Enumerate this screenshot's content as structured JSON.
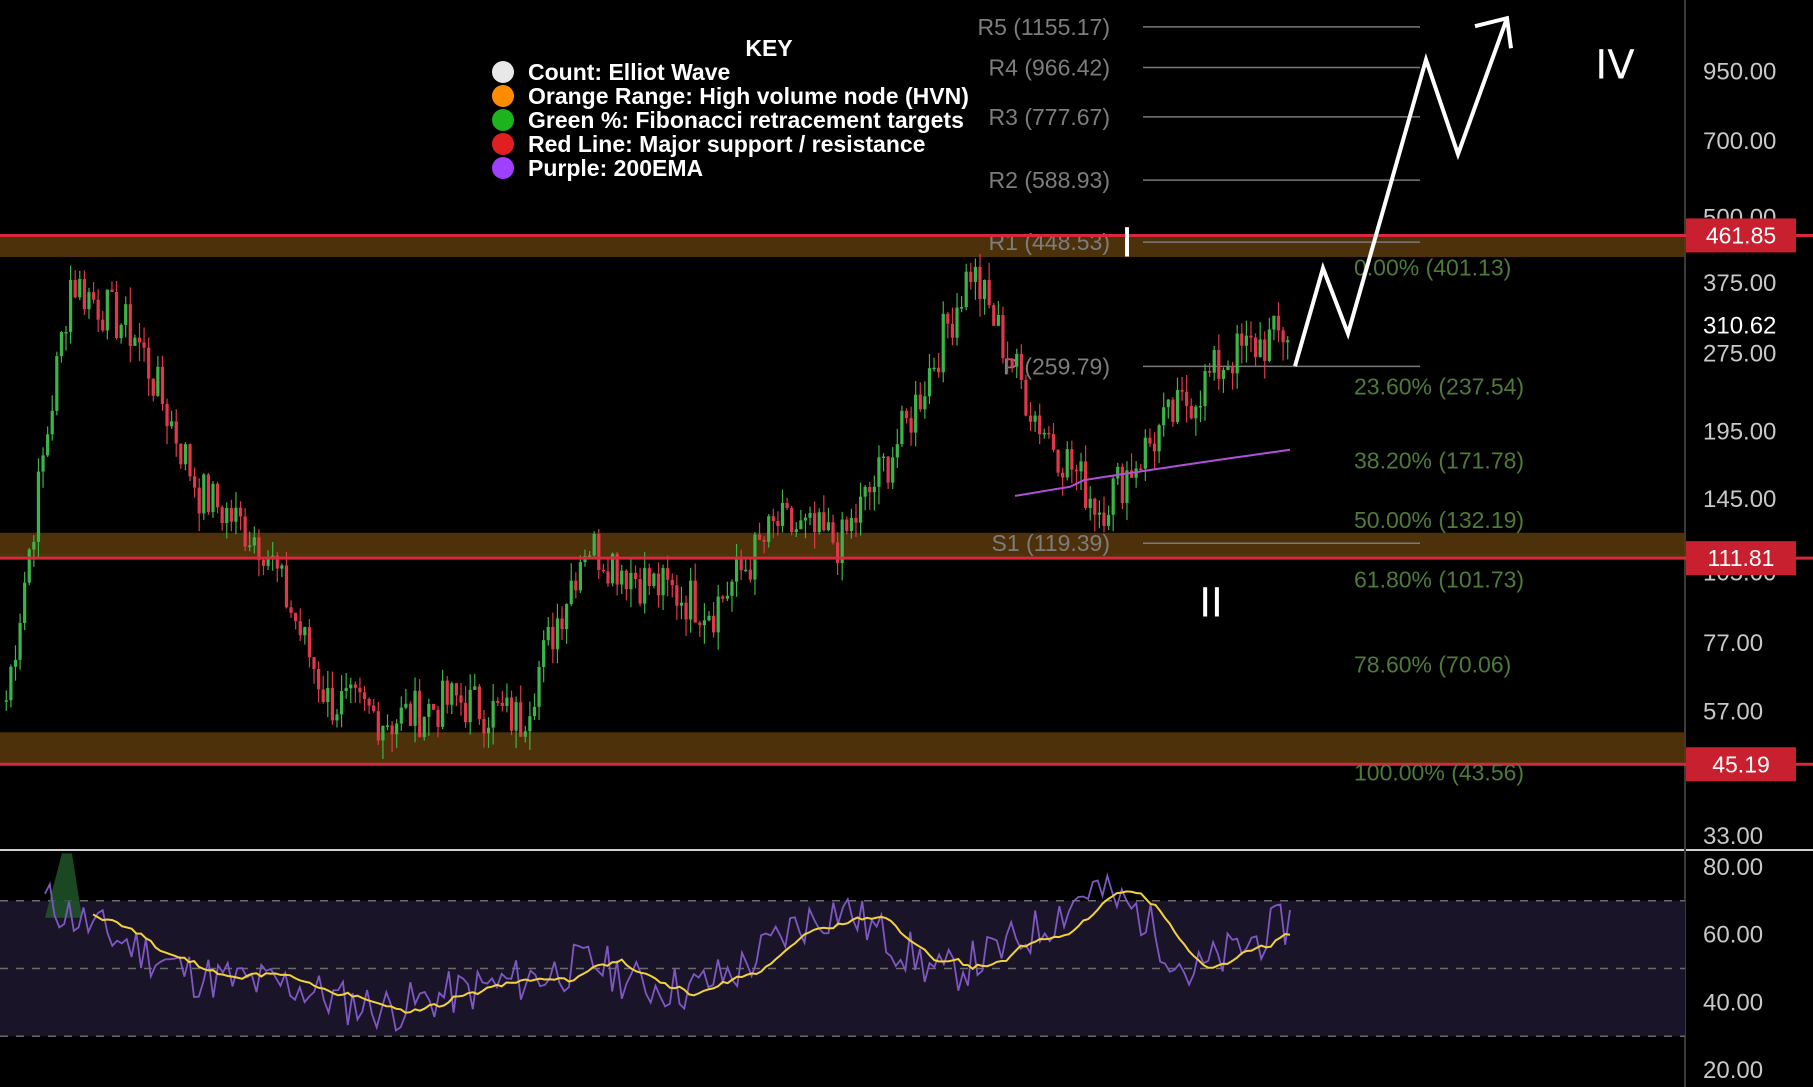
{
  "chart_data": {
    "type": "candlestick",
    "price_axis": {
      "scale": "log",
      "range": [
        31,
        1300
      ],
      "ticks": [
        "950.00",
        "700.00",
        "500.00",
        "375.00",
        "275.00",
        "195.00",
        "145.00",
        "105.00",
        "77.00",
        "57.00",
        "45.00",
        "33.00"
      ]
    },
    "current_price": "310.62",
    "price_tags": [
      {
        "label": "461.85",
        "value": 461.85
      },
      {
        "label": "111.81",
        "value": 111.81
      },
      {
        "label": "45.19",
        "value": 45.19
      }
    ],
    "key": {
      "title": "KEY",
      "items": [
        {
          "label": "Count: Elliot Wave",
          "color": "#e8e8e8"
        },
        {
          "label": "Orange Range: High volume node (HVN)",
          "color": "#ff8c00"
        },
        {
          "label": "Green %: Fibonacci retracement targets",
          "color": "#1db31d"
        },
        {
          "label": "Red Line: Major support / resistance",
          "color": "#e02020"
        },
        {
          "label": "Purple: 200EMA",
          "color": "#a040ff"
        }
      ]
    },
    "pivots": [
      {
        "label": "R5 (1155.17)",
        "value": 1155.17
      },
      {
        "label": "R4 (966.42)",
        "value": 966.42
      },
      {
        "label": "R3 (777.67)",
        "value": 777.67
      },
      {
        "label": "R2 (588.93)",
        "value": 588.93
      },
      {
        "label": "R1 (448.53)",
        "value": 448.53
      },
      {
        "label": "P (259.79)",
        "value": 259.79
      },
      {
        "label": "S1 (119.39)",
        "value": 119.39
      }
    ],
    "fibonacci": [
      {
        "label": "0.00% (401.13)",
        "value": 401.13
      },
      {
        "label": "23.60% (237.54)",
        "value": 237.54
      },
      {
        "label": "38.20% (171.78)",
        "value": 171.78
      },
      {
        "label": "50.00% (132.19)",
        "value": 132.19
      },
      {
        "label": "61.80% (101.73)",
        "value": 101.73
      },
      {
        "label": "78.60% (70.06)",
        "value": 70.06
      },
      {
        "label": "100.00% (43.56)",
        "value": 43.56
      }
    ],
    "support_resistance": [
      461.85,
      111.81,
      45.19
    ],
    "hvn_zones": [
      [
        420,
        461.85
      ],
      [
        111.81,
        125
      ],
      [
        45.19,
        52
      ]
    ],
    "wave_labels": [
      {
        "label": "I",
        "value": 448
      },
      {
        "label": "II",
        "value": 92
      },
      {
        "label": "IV",
        "value": 980
      }
    ],
    "projection_path": [
      260,
      400,
      300,
      1000,
      660,
      1200
    ],
    "candles_seed": {
      "closes": [
        60,
        380,
        300,
        150,
        120,
        60,
        55,
        60,
        55,
        120,
        100,
        90,
        130,
        120,
        200,
        400,
        210,
        140,
        200,
        270,
        305
      ],
      "candles_per_segment": 14
    },
    "rsi": {
      "ticks": [
        "80.00",
        "60.00",
        "40.00",
        "20.00"
      ],
      "range": [
        15,
        85
      ],
      "band": [
        30,
        70
      ],
      "mid": 50,
      "line_seed": [
        70,
        62,
        55,
        48,
        46,
        45,
        40,
        38,
        42,
        45,
        48,
        52,
        45,
        44,
        50,
        62,
        68,
        58,
        48,
        54,
        62,
        74,
        66,
        48,
        56,
        64
      ],
      "colors": {
        "rsi": "#7e57c2",
        "ma": "#f2d23c",
        "band_fill": "#1a1428"
      }
    },
    "colors": {
      "up": "#3bb54a",
      "down": "#e0384a",
      "red_line": "#d9283c",
      "hvn": "#5a3a0c",
      "ema": "#b04fd8",
      "pivot_line": "#7a7a7a",
      "price_tag_bg": "#c8202e"
    }
  }
}
